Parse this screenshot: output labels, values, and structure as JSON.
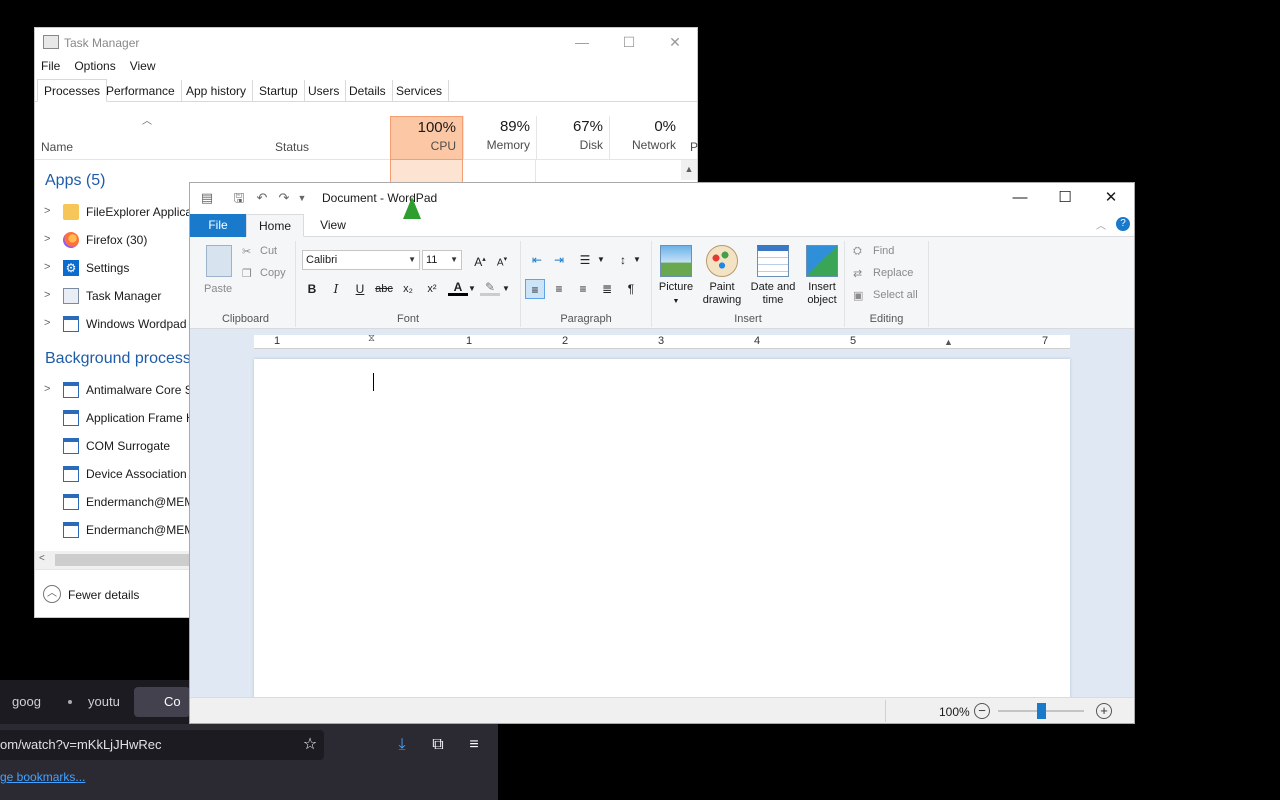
{
  "browser": {
    "tabs": [
      "goog",
      "youtu",
      "Co"
    ],
    "url": "om/watch?v=mKkLjJHwRec",
    "bookmarks_link": "ge bookmarks..."
  },
  "taskmanager": {
    "title": "Task Manager",
    "menu": [
      "File",
      "Options",
      "View"
    ],
    "tabs": [
      "Processes",
      "Performance",
      "App history",
      "Startup",
      "Users",
      "Details",
      "Services"
    ],
    "col_name": "Name",
    "col_status": "Status",
    "metrics": [
      {
        "pct": "100%",
        "label": "CPU"
      },
      {
        "pct": "89%",
        "label": "Memory"
      },
      {
        "pct": "67%",
        "label": "Disk"
      },
      {
        "pct": "0%",
        "label": "Network"
      }
    ],
    "metric_cut": "P",
    "apps_header": "Apps (5)",
    "apps": [
      {
        "name": "FileExplorer Applica"
      },
      {
        "name": "Firefox (30)"
      },
      {
        "name": "Settings"
      },
      {
        "name": "Task Manager"
      },
      {
        "name": "Windows Wordpad"
      }
    ],
    "bg_header": "Background processes",
    "bg": [
      {
        "name": "Antimalware Core S"
      },
      {
        "name": "Application Frame H"
      },
      {
        "name": "COM Surrogate"
      },
      {
        "name": "Device Association F"
      },
      {
        "name": "Endermanch@MEM"
      },
      {
        "name": "Endermanch@MEM"
      }
    ],
    "fewer_details": "Fewer details"
  },
  "wordpad": {
    "title": "Document - WordPad",
    "tabs": {
      "file": "File",
      "home": "Home",
      "view": "View"
    },
    "clipboard": {
      "paste": "Paste",
      "cut": "Cut",
      "copy": "Copy",
      "label": "Clipboard"
    },
    "font": {
      "family": "Calibri",
      "size": "11",
      "label": "Font"
    },
    "paragraph_label": "Paragraph",
    "insert": {
      "picture": "Picture",
      "paint1": "Paint",
      "paint2": "drawing",
      "date1": "Date and",
      "date2": "time",
      "obj1": "Insert",
      "obj2": "object",
      "label": "Insert"
    },
    "editing": {
      "find": "Find",
      "replace": "Replace",
      "selectall": "Select all",
      "label": "Editing"
    },
    "ruler": [
      "1",
      "1",
      "2",
      "3",
      "4",
      "5",
      "7"
    ],
    "zoom": "100%",
    "zoom_level": 0.5
  }
}
